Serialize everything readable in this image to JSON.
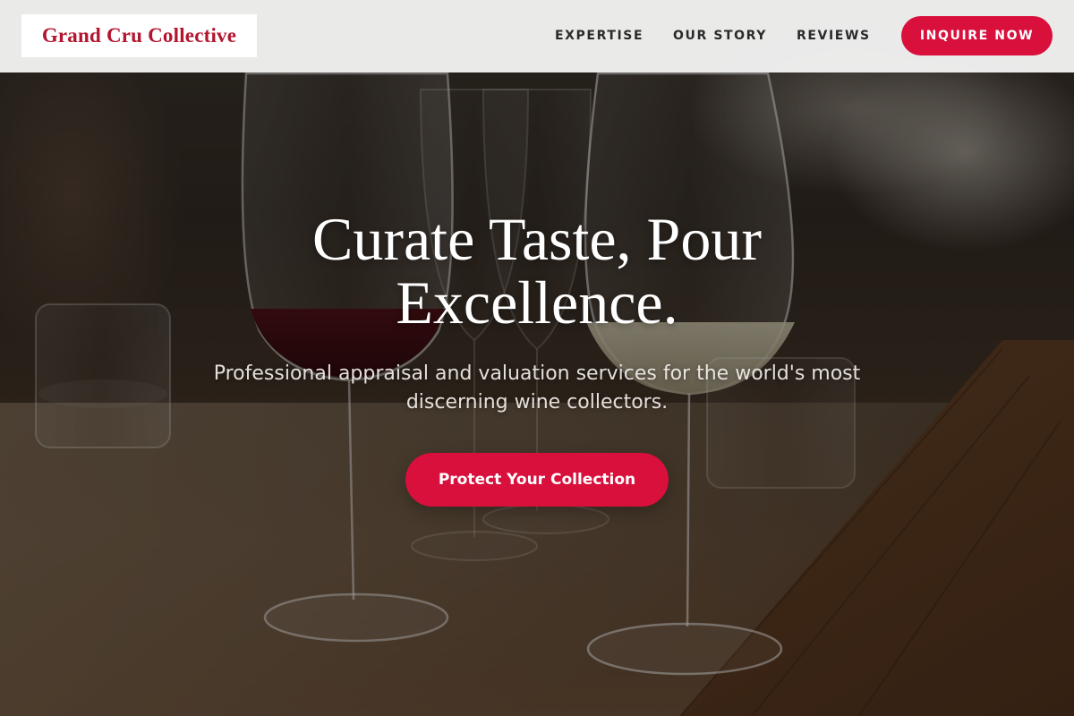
{
  "header": {
    "brand": "Grand Cru Collective",
    "nav": [
      {
        "label": "EXPERTISE"
      },
      {
        "label": "OUR STORY"
      },
      {
        "label": "REVIEWS"
      }
    ],
    "cta_label": "INQUIRE NOW"
  },
  "hero": {
    "headline": "Curate Taste, Pour Excellence.",
    "subhead": "Professional appraisal and valuation services for the world's most discerning wine collectors.",
    "cta_label": "Protect Your Collection",
    "background_image": "wine-glasses-on-bar-photo"
  },
  "colors": {
    "accent": "#d90f3c",
    "brand_text": "#b3152e",
    "header_bg": "#f6f6f6",
    "nav_text": "#2a2a2a",
    "hero_text": "#ffffff"
  }
}
